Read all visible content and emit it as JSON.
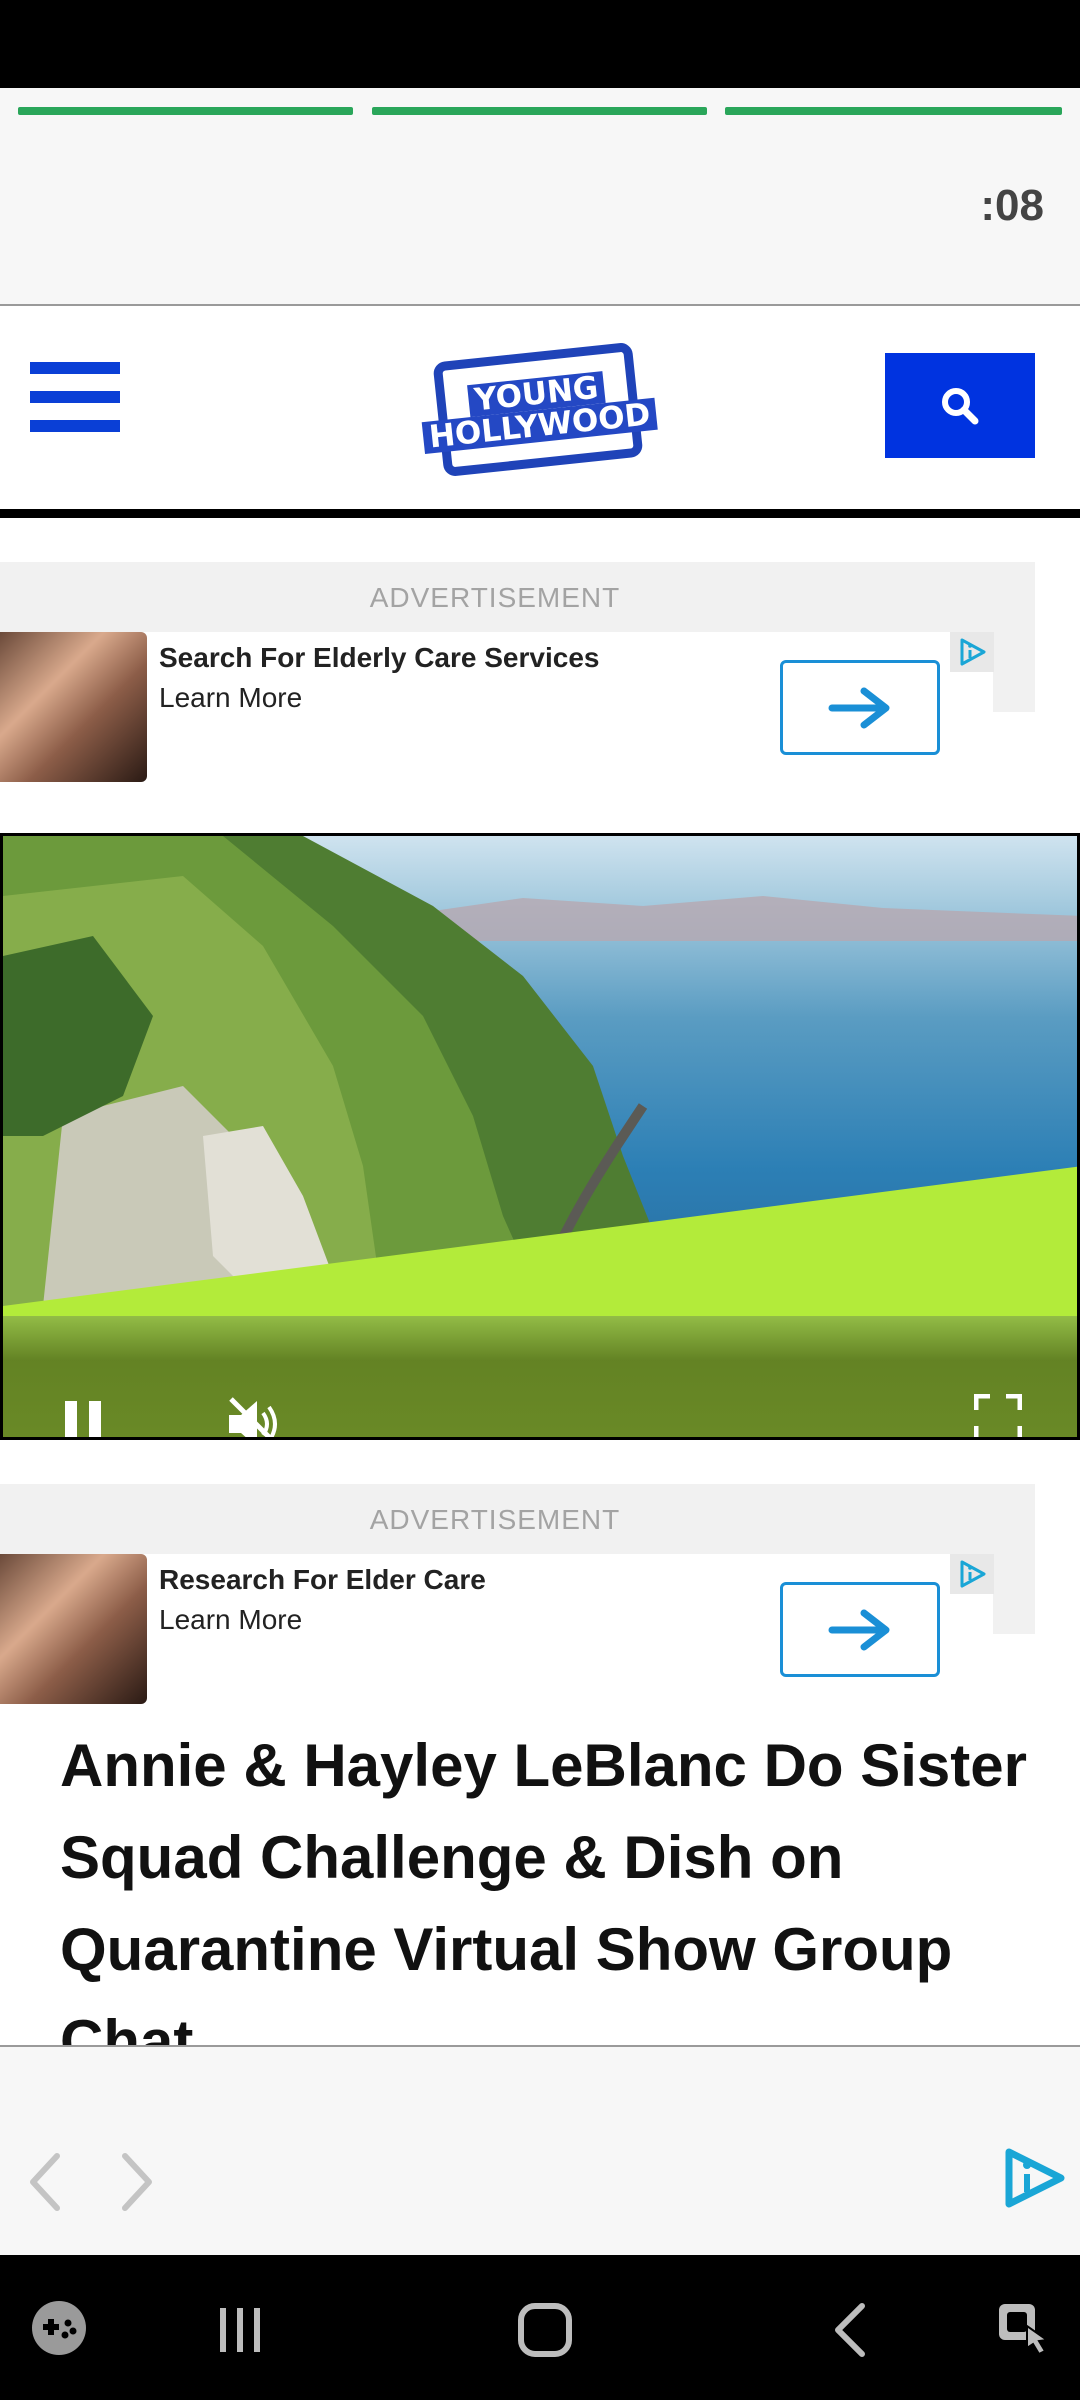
{
  "story": {
    "timer": ":08",
    "segments": 3
  },
  "header": {
    "logo_line1": "YOUNG",
    "logo_line2": "HOLLYWOOD"
  },
  "ads": [
    {
      "label": "ADVERTISEMENT",
      "title": "Search For Elderly Care Services",
      "subtitle": "Learn More"
    },
    {
      "label": "ADVERTISEMENT",
      "title": "Research For Elder Care",
      "subtitle": "Learn More"
    }
  ],
  "video": {
    "state": "playing",
    "muted": true
  },
  "article": {
    "title": "Annie & Hayley LeBlanc Do Sister Squad Challenge & Dish on Quarantine Virtual Show Group Chat"
  },
  "colors": {
    "brand_blue": "#0033e0",
    "progress_green": "#2aa65a",
    "ad_arrow_blue": "#1a8fd6"
  },
  "icons": {
    "menu": "hamburger-icon",
    "search": "search-icon",
    "ad_arrow": "arrow-right-icon",
    "ad_choice": "ad-choices-icon",
    "pause": "pause-icon",
    "mute": "volume-muted-icon",
    "fullscreen": "fullscreen-icon",
    "back": "chevron-left-icon",
    "forward": "chevron-right-icon",
    "brand": "play-info-icon"
  }
}
